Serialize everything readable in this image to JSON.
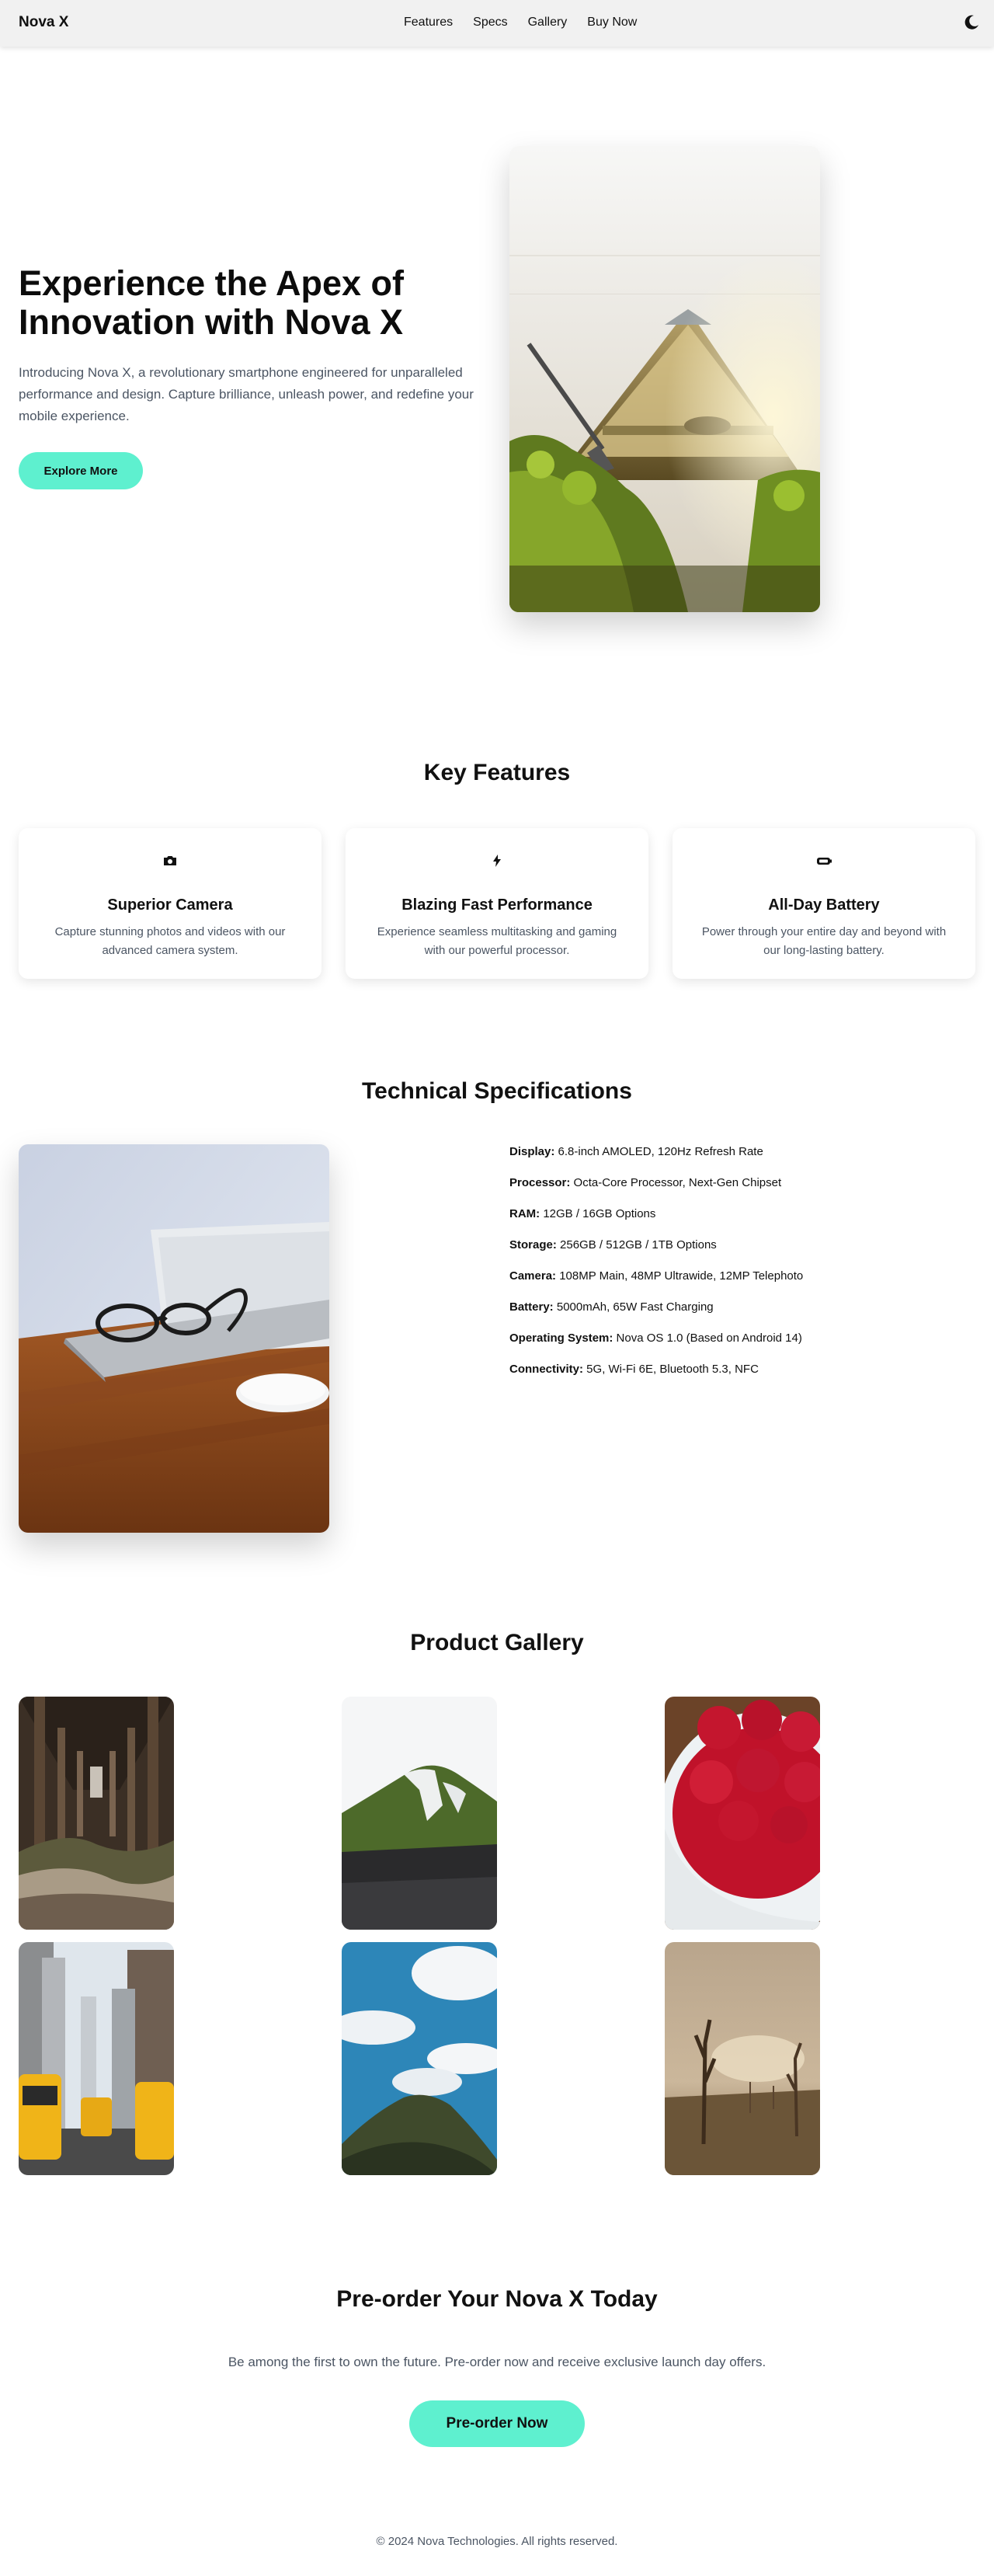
{
  "nav": {
    "brand": "Nova X",
    "links": [
      "Features",
      "Specs",
      "Gallery",
      "Buy Now"
    ],
    "theme_icon": "moon-icon"
  },
  "hero": {
    "title": "Experience the Apex of Innovation with Nova X",
    "text": "Introducing Nova X, a revolutionary smartphone engineered for unparalleled performance and design. Capture brilliance, unleash power, and redefine your mobile experience.",
    "button": "Explore More",
    "image": "canoe-photo"
  },
  "features": {
    "title": "Key Features",
    "items": [
      {
        "icon": "camera-icon",
        "title": "Superior Camera",
        "desc": "Capture stunning photos and videos with our advanced camera system."
      },
      {
        "icon": "bolt-icon",
        "title": "Blazing Fast Performance",
        "desc": "Experience seamless multitasking and gaming with our powerful processor."
      },
      {
        "icon": "battery-icon",
        "title": "All-Day Battery",
        "desc": "Power through your entire day and beyond with our long-lasting battery."
      }
    ]
  },
  "specs": {
    "title": "Technical Specifications",
    "image": "laptop-glasses-photo",
    "items": [
      {
        "label": "Display:",
        "value": " 6.8-inch AMOLED, 120Hz Refresh Rate"
      },
      {
        "label": "Processor:",
        "value": " Octa-Core Processor, Next-Gen Chipset"
      },
      {
        "label": "RAM:",
        "value": " 12GB / 16GB Options"
      },
      {
        "label": "Storage:",
        "value": " 256GB / 512GB / 1TB Options"
      },
      {
        "label": "Camera:",
        "value": " 108MP Main, 48MP Ultrawide, 12MP Telephoto"
      },
      {
        "label": "Battery:",
        "value": " 5000mAh, 65W Fast Charging"
      },
      {
        "label": "Operating System:",
        "value": " Nova OS 1.0 (Based on Android 14)"
      },
      {
        "label": "Connectivity:",
        "value": " 5G, Wi-Fi 6E, Bluetooth 5.3, NFC"
      }
    ]
  },
  "gallery": {
    "title": "Product Gallery",
    "images": [
      "pier-photo",
      "mountain-photo",
      "raspberries-photo",
      "city-taxis-photo",
      "cliff-sky-photo",
      "dead-trees-photo"
    ]
  },
  "preorder": {
    "title": "Pre-order Your Nova X Today",
    "text": "Be among the first to own the future. Pre-order now and receive exclusive launch day offers.",
    "button": "Pre-order Now"
  },
  "footer": {
    "text": "© 2024 Nova Technologies. All rights reserved."
  }
}
